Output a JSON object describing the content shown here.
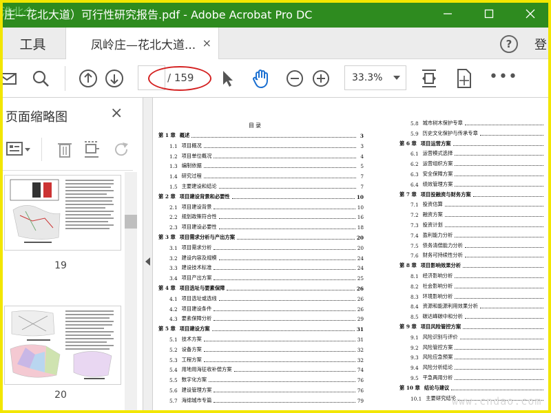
{
  "window": {
    "title": "庄—花北大道）可行性研究报告.pdf - Adobe Acrobat Pro DC",
    "watermark_corner": "淮北个"
  },
  "tabs": {
    "tools": "工具",
    "document": "凤岭庄—花北大道...",
    "close_glyph": "×",
    "help_glyph": "?",
    "login": "登"
  },
  "toolbar": {
    "current_page": "",
    "total_pages": "/ 159",
    "zoom": "33.3%",
    "more": "•••"
  },
  "left_panel": {
    "title": "页面缩略图",
    "thumbnails": [
      {
        "page": "19"
      },
      {
        "page": "20"
      }
    ]
  },
  "document": {
    "toc_title": "目录",
    "left_column": [
      {
        "num": "第 1 章",
        "text": "概述",
        "page": "3",
        "chapter": true
      },
      {
        "num": "1.1",
        "text": "项目概况",
        "page": "3"
      },
      {
        "num": "1.2",
        "text": "项目单位概况",
        "page": "4"
      },
      {
        "num": "1.3",
        "text": "编制依据",
        "page": "5"
      },
      {
        "num": "1.4",
        "text": "研究过程",
        "page": "7"
      },
      {
        "num": "1.5",
        "text": "主要建设和结论",
        "page": "7"
      },
      {
        "num": "第 2 章",
        "text": "项目建设背景和必要性",
        "page": "10",
        "chapter": true
      },
      {
        "num": "2.1",
        "text": "项目建设背景",
        "page": "10"
      },
      {
        "num": "2.2",
        "text": "规划政策符合性",
        "page": "16"
      },
      {
        "num": "2.3",
        "text": "项目建设必要性",
        "page": "18"
      },
      {
        "num": "第 3 章",
        "text": "项目需求分析与产出方案",
        "page": "20",
        "chapter": true
      },
      {
        "num": "3.1",
        "text": "项目需求分析",
        "page": "20"
      },
      {
        "num": "3.2",
        "text": "建设内容及规模",
        "page": "24"
      },
      {
        "num": "3.3",
        "text": "建设技术标准",
        "page": "24"
      },
      {
        "num": "3.4",
        "text": "项目产出方案",
        "page": "25"
      },
      {
        "num": "第 4 章",
        "text": "项目选址与要素保障",
        "page": "26",
        "chapter": true
      },
      {
        "num": "4.1",
        "text": "项目选址或选线",
        "page": "26"
      },
      {
        "num": "4.2",
        "text": "项目建设条件",
        "page": "26"
      },
      {
        "num": "4.3",
        "text": "要素保障分析",
        "page": "29"
      },
      {
        "num": "第 5 章",
        "text": "项目建设方案",
        "page": "31",
        "chapter": true
      },
      {
        "num": "5.1",
        "text": "技术方案",
        "page": "31"
      },
      {
        "num": "5.2",
        "text": "设备方案",
        "page": "32"
      },
      {
        "num": "5.3",
        "text": "工程方案",
        "page": "32"
      },
      {
        "num": "5.4",
        "text": "用地用海征收补偿方案",
        "page": "74"
      },
      {
        "num": "5.5",
        "text": "数字化方案",
        "page": "76"
      },
      {
        "num": "5.6",
        "text": "建设管理方案",
        "page": "76"
      },
      {
        "num": "5.7",
        "text": "海绵城市专篇",
        "page": "79"
      }
    ],
    "right_column": [
      {
        "num": "5.8",
        "text": "城市树木保护专章",
        "page": ""
      },
      {
        "num": "5.9",
        "text": "历史文化保护与传承专章",
        "page": ""
      },
      {
        "num": "第 6 章",
        "text": "项目运营方案",
        "page": "",
        "chapter": true
      },
      {
        "num": "6.1",
        "text": "运营模式选择",
        "page": ""
      },
      {
        "num": "6.2",
        "text": "运营组织方案",
        "page": ""
      },
      {
        "num": "6.3",
        "text": "安全保障方案",
        "page": ""
      },
      {
        "num": "6.4",
        "text": "绩效管理方案",
        "page": ""
      },
      {
        "num": "第 7 章",
        "text": "项目投融资与财务方案",
        "page": "",
        "chapter": true
      },
      {
        "num": "7.1",
        "text": "投资估算",
        "page": ""
      },
      {
        "num": "7.2",
        "text": "融资方案",
        "page": ""
      },
      {
        "num": "7.3",
        "text": "投资计划",
        "page": ""
      },
      {
        "num": "7.4",
        "text": "盈利能力分析",
        "page": ""
      },
      {
        "num": "7.5",
        "text": "债务清偿能力分析",
        "page": ""
      },
      {
        "num": "7.6",
        "text": "财务可持续性分析",
        "page": ""
      },
      {
        "num": "第 8 章",
        "text": "项目影响效果分析",
        "page": "",
        "chapter": true
      },
      {
        "num": "8.1",
        "text": "经济影响分析",
        "page": ""
      },
      {
        "num": "8.2",
        "text": "社会影响分析",
        "page": ""
      },
      {
        "num": "8.3",
        "text": "环境影响分析",
        "page": ""
      },
      {
        "num": "8.4",
        "text": "资源和能源利用效果分析",
        "page": ""
      },
      {
        "num": "8.5",
        "text": "碳达峰碳中和分析",
        "page": ""
      },
      {
        "num": "第 9 章",
        "text": "项目风险管控方案",
        "page": "",
        "chapter": true
      },
      {
        "num": "9.1",
        "text": "风险识别与评价",
        "page": ""
      },
      {
        "num": "9.2",
        "text": "风险管控方案",
        "page": ""
      },
      {
        "num": "9.3",
        "text": "风险应急预案",
        "page": ""
      },
      {
        "num": "9.4",
        "text": "风险分析结论",
        "page": ""
      },
      {
        "num": "9.5",
        "text": "平急两用分析",
        "page": ""
      },
      {
        "num": "第 10 章",
        "text": "结论与建议",
        "page": "",
        "chapter": true
      },
      {
        "num": "10.1",
        "text": "主要研究结论",
        "page": ""
      }
    ]
  },
  "watermark": "www.cndao.com",
  "colors": {
    "titlebar": "#2e8b1f",
    "frame": "#f2e600",
    "annotation": "#d42020",
    "hand_tool": "#1a6fd1"
  }
}
